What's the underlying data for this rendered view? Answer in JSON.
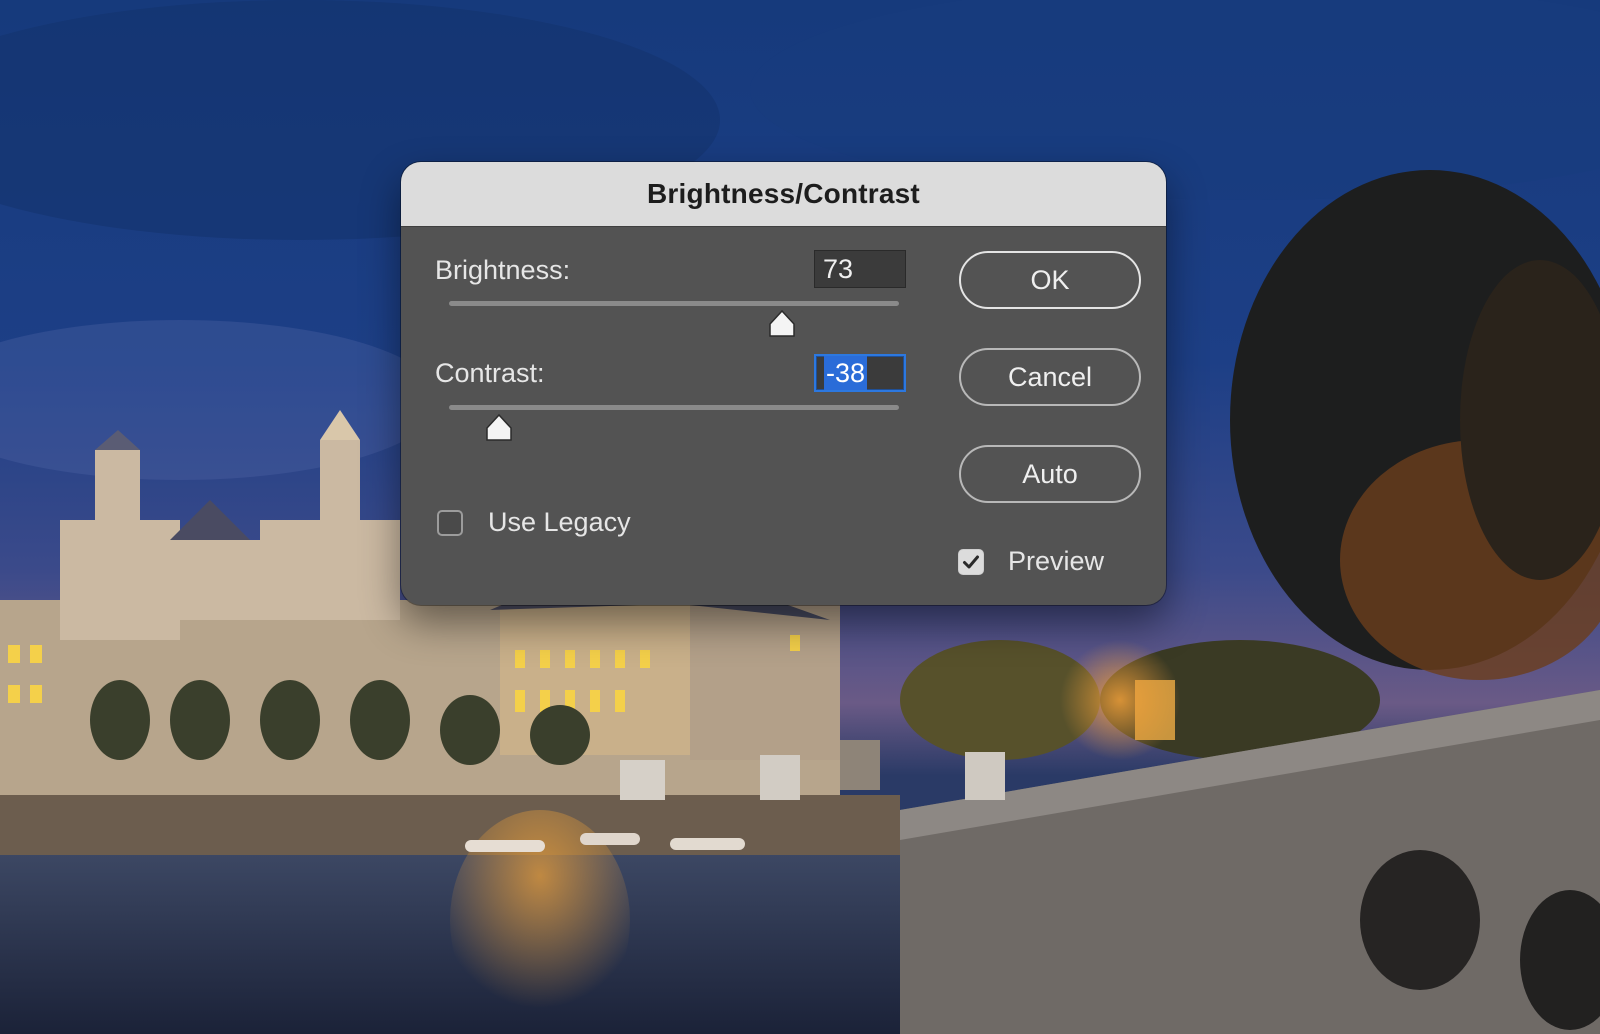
{
  "dialog": {
    "title": "Brightness/Contrast",
    "brightness": {
      "label": "Brightness:",
      "value": "73",
      "slider_fraction": 0.74
    },
    "contrast": {
      "label": "Contrast:",
      "value": "-38",
      "slider_fraction": 0.11
    },
    "buttons": {
      "ok": "OK",
      "cancel": "Cancel",
      "auto": "Auto"
    },
    "use_legacy": {
      "label": "Use Legacy",
      "checked": false
    },
    "preview": {
      "label": "Preview",
      "checked": true
    }
  },
  "icons": {
    "slider_thumb": "slider-thumb-icon",
    "checkmark": "checkmark-icon"
  },
  "colors": {
    "dialog_bg": "#535353",
    "titlebar_bg": "#dcdcdc",
    "focus_ring": "#2c78e0",
    "selection": "#2a6cd8"
  }
}
